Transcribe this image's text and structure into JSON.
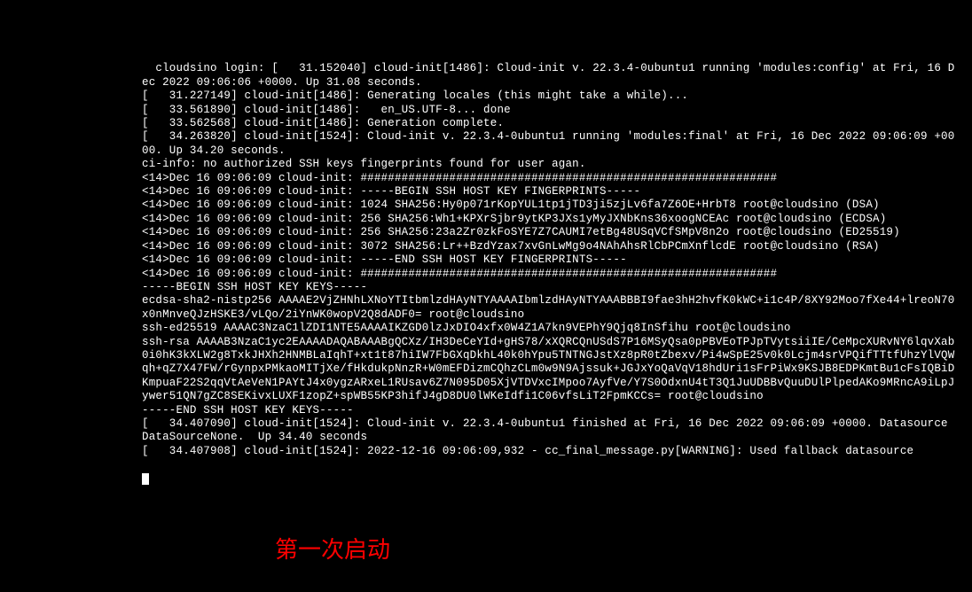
{
  "terminal": {
    "lines": [
      "cloudsino login: [   31.152040] cloud-init[1486]: Cloud-init v. 22.3.4-0ubuntu1 running 'modules:config' at Fri, 16 Dec 2022 09:06:06 +0000. Up 31.08 seconds.",
      "[   31.227149] cloud-init[1486]: Generating locales (this might take a while)...",
      "[   33.561890] cloud-init[1486]:   en_US.UTF-8... done",
      "[   33.562568] cloud-init[1486]: Generation complete.",
      "[   34.263820] cloud-init[1524]: Cloud-init v. 22.3.4-0ubuntu1 running 'modules:final' at Fri, 16 Dec 2022 09:06:09 +0000. Up 34.20 seconds.",
      "ci-info: no authorized SSH keys fingerprints found for user agan.",
      "<14>Dec 16 09:06:09 cloud-init: #############################################################",
      "<14>Dec 16 09:06:09 cloud-init: -----BEGIN SSH HOST KEY FINGERPRINTS-----",
      "<14>Dec 16 09:06:09 cloud-init: 1024 SHA256:Hy0p071rKopYUL1tp1jTD3ji5zjLv6fa7Z6OE+HrbT8 root@cloudsino (DSA)",
      "<14>Dec 16 09:06:09 cloud-init: 256 SHA256:Wh1+KPXrSjbr9ytKP3JXs1yMyJXNbKns36xoogNCEAc root@cloudsino (ECDSA)",
      "<14>Dec 16 09:06:09 cloud-init: 256 SHA256:23a2Zr0zkFoSYE7Z7CAUMI7etBg48USqVCfSMpV8n2o root@cloudsino (ED25519)",
      "<14>Dec 16 09:06:09 cloud-init: 3072 SHA256:Lr++BzdYzax7xvGnLwMg9o4NAhAhsRlCbPCmXnflcdE root@cloudsino (RSA)",
      "<14>Dec 16 09:06:09 cloud-init: -----END SSH HOST KEY FINGERPRINTS-----",
      "<14>Dec 16 09:06:09 cloud-init: #############################################################",
      "-----BEGIN SSH HOST KEY KEYS-----",
      "ecdsa-sha2-nistp256 AAAAE2VjZHNhLXNoYTItbmlzdHAyNTYAAAAIbmlzdHAyNTYAAABBBI9fae3hH2hvfK0kWC+i1c4P/8XY92Moo7fXe44+lreoN70x0nMnveQJzHSKE3/vLQo/2iYnWK0wopV2Q8dADF0= root@cloudsino",
      "ssh-ed25519 AAAAC3NzaC1lZDI1NTE5AAAAIKZGD0lzJxDIO4xfx0W4Z1A7kn9VEPhY9Qjq8InSfihu root@cloudsino",
      "ssh-rsa AAAAB3NzaC1yc2EAAAADAQABAAABgQCXz/IH3DeCeYId+gHS78/xXQRCQnUSdS7P16MSyQsa0pPBVEoTPJpTVytsiiIE/CeMpcXURvNY6lqvXab0i0hK3kXLW2g8TxkJHXh2HNMBLaIqhT+xt1t87hiIW7FbGXqDkhL40k0hYpu5TNTNGJstXz8pR0tZbexv/Pi4wSpE25v0k0Lcjm4srVPQifTTtfUhzYlVQWqh+qZ7X47FW/rGynpxPMkaoMITjXe/fHkdukpNnzR+W0mEFDizmCQhzCLm0w9N9Ajssuk+JGJxYoQaVqV18hdUri1sFrPiWx9KSJB8EDPKmtBu1cFsIQBiDKmpuaF22S2qqVtAeVeN1PAYtJ4x0ygzARxeL1RUsav6Z7N095D05XjVTDVxcIMpoo7AyfVe/Y7S0OdxnU4tT3Q1JuUDBBvQuuDUlPlpedAKo9MRncA9iLpJywer51QN7gZC8SEKivxLUXF1zopZ+spWB55KP3hifJ4gD8DU0lWKeIdfi1C06vfsLiT2FpmKCCs= root@cloudsino",
      "-----END SSH HOST KEY KEYS-----",
      "[   34.407090] cloud-init[1524]: Cloud-init v. 22.3.4-0ubuntu1 finished at Fri, 16 Dec 2022 09:06:09 +0000. Datasource DataSourceNone.  Up 34.40 seconds",
      "[   34.407908] cloud-init[1524]: 2022-12-16 09:06:09,932 - cc_final_message.py[WARNING]: Used fallback datasource"
    ]
  },
  "caption": "第一次启动"
}
